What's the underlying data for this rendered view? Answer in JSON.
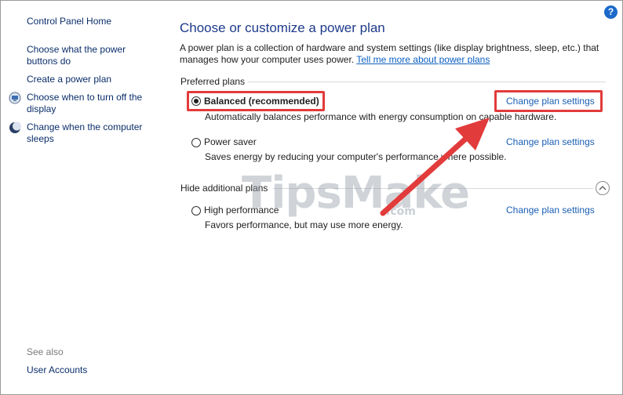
{
  "sidebar": {
    "home": "Control Panel Home",
    "items": [
      {
        "label_line1": "Choose what the power",
        "label_line2": "buttons do",
        "icon": null
      },
      {
        "label_line1": "Create a power plan",
        "label_line2": "",
        "icon": null
      },
      {
        "label_line1": "Choose when to turn off the",
        "label_line2": "display",
        "icon": "monitor-icon"
      },
      {
        "label_line1": "Change when the computer",
        "label_line2": "sleeps",
        "icon": "moon-icon"
      }
    ],
    "see_also": "See also",
    "user_accounts": "User Accounts"
  },
  "help": "?",
  "main": {
    "title": "Choose or customize a power plan",
    "desc_line1": "A power plan is a collection of hardware and system settings (like display brightness, sleep, etc.) that",
    "desc_line2": "manages how your computer uses power.",
    "desc_link": "Tell me more about power plans",
    "preferred_label": "Preferred plans",
    "hidden_label": "Hide additional plans",
    "plans": [
      {
        "name": "Balanced (recommended)",
        "desc": "Automatically balances performance with energy consumption on capable hardware.",
        "selected": true,
        "link": "Change plan settings"
      },
      {
        "name": "Power saver",
        "desc": "Saves energy by reducing your computer's performance where possible.",
        "selected": false,
        "link": "Change plan settings"
      },
      {
        "name": "High performance",
        "desc": "Favors performance, but may use more energy.",
        "selected": false,
        "link": "Change plan settings"
      }
    ]
  },
  "watermark": {
    "main": "TipsMake",
    "suffix": ".com"
  },
  "colors": {
    "highlight": "#e23b3b",
    "link": "#1a5fb4",
    "title": "#1e3a8a"
  }
}
